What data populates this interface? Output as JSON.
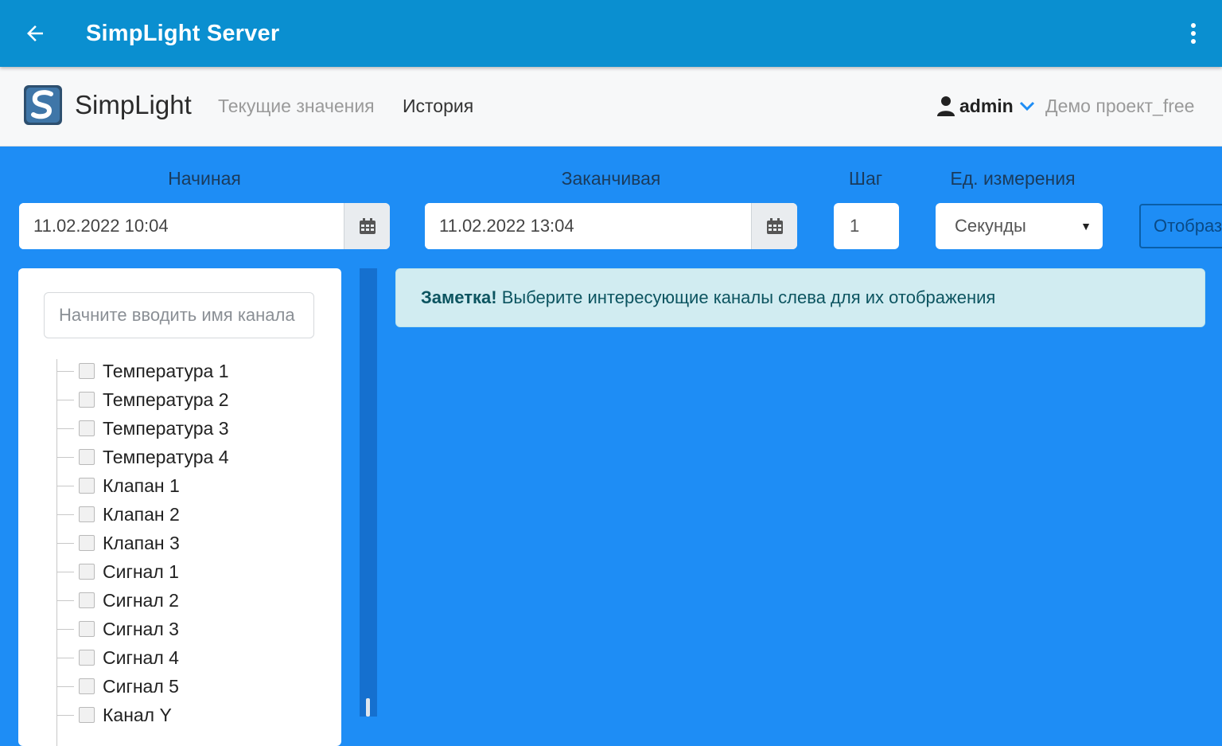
{
  "appbar": {
    "title": "SimpLight Server",
    "back_icon": "arrow-back-icon",
    "menu_icon": "more-vert-icon"
  },
  "navbar": {
    "brand": "SimpLight",
    "links": [
      "Текущие значения",
      "История"
    ],
    "user": "admin",
    "project": "Демо проект_free"
  },
  "filters": {
    "start_label": "Начиная",
    "start_value": "11.02.2022 10:04",
    "end_label": "Заканчивая",
    "end_value": "11.02.2022 13:04",
    "step_label": "Шаг",
    "step_value": "1",
    "unit_label": "Ед. измерения",
    "unit_value": "Секунды",
    "show_button": "Отобразить"
  },
  "tree": {
    "search_placeholder": "Начните вводить имя канала",
    "items": [
      "Температура 1",
      "Температура 2",
      "Температура 3",
      "Температура 4",
      "Клапан 1",
      "Клапан 2",
      "Клапан 3",
      "Сигнал 1",
      "Сигнал 2",
      "Сигнал 3",
      "Сигнал 4",
      "Сигнал 5",
      "Канал Y"
    ]
  },
  "note": {
    "strong": "Заметка!",
    "text": " Выберите интересующие каналы слева для их отображения"
  },
  "colors": {
    "appbar": "#0a8fd0",
    "background": "#1e8df5",
    "navbar": "#f7f8f9",
    "alert_bg": "#d1ecf1",
    "alert_text": "#0c5460"
  }
}
